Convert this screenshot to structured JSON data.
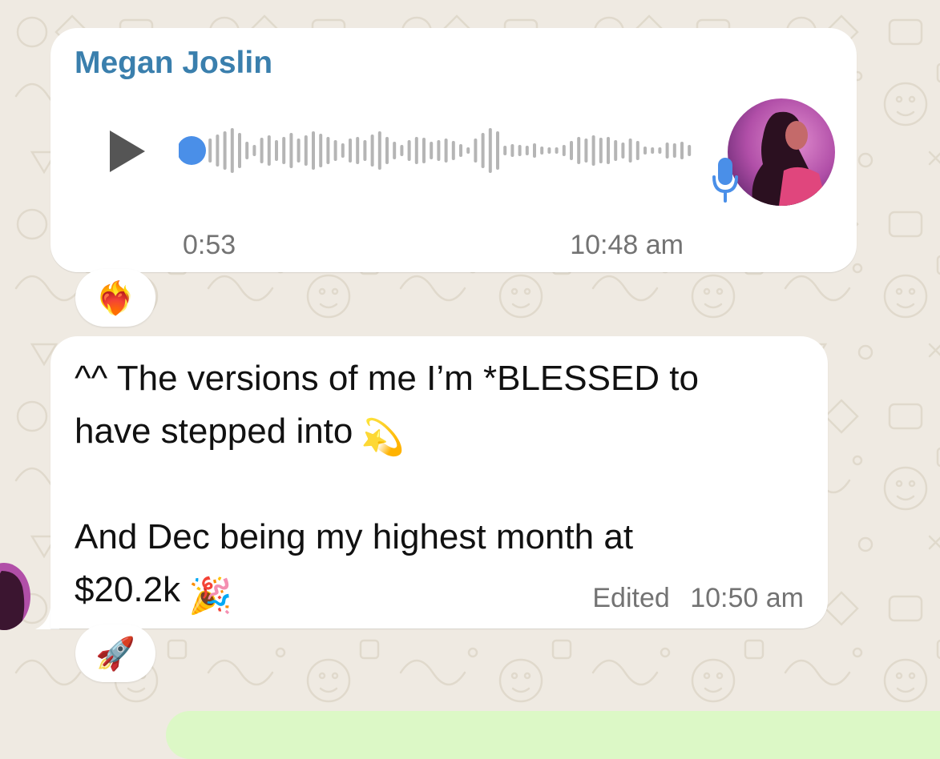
{
  "theme": {
    "background": "#efeae2",
    "bubble": "#ffffff",
    "sender_color": "#3a7fad",
    "meta_color": "#737373",
    "waveform_played": "#4a8fe8",
    "waveform_unplayed": "#b5b5b5",
    "outgoing_bubble": "#dcf8c6"
  },
  "voice_message": {
    "sender": "Megan Joslin",
    "play_icon": "play-icon",
    "mic_icon": "microphone-icon",
    "duration": "0:53",
    "progress": 0,
    "time": "10:48 am",
    "reaction": "❤️‍🔥"
  },
  "text_message": {
    "lines": [
      "^^ The versions of me I’m *BLESSED to",
      "have stepped into",
      "",
      "And Dec being my highest month at",
      "$20.2k"
    ],
    "line2_emoji": "💫",
    "line5_emoji": "🎉",
    "edited_label": "Edited",
    "time": "10:50 am",
    "reaction": "🚀"
  }
}
